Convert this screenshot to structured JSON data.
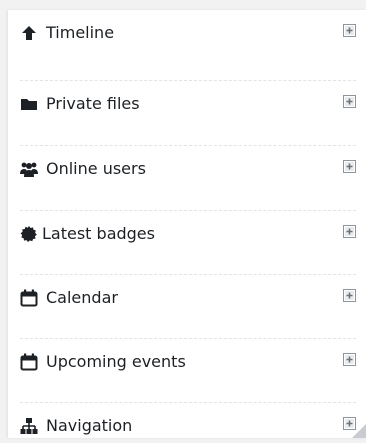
{
  "blocks": [
    {
      "title": "Timeline",
      "icon": "arrow-up-icon"
    },
    {
      "title": "Private files",
      "icon": "folder-icon"
    },
    {
      "title": "Online users",
      "icon": "users-icon"
    },
    {
      "title": "Latest badges",
      "icon": "badge-certificate-icon"
    },
    {
      "title": "Calendar",
      "icon": "calendar-icon"
    },
    {
      "title": "Upcoming events",
      "icon": "calendar-icon"
    },
    {
      "title": "Navigation",
      "icon": "sitemap-icon"
    }
  ],
  "colors": {
    "text": "#1d2125",
    "icon": "#1d2125",
    "add_icon": "#8f959e",
    "separator": "#e3e3e3"
  }
}
